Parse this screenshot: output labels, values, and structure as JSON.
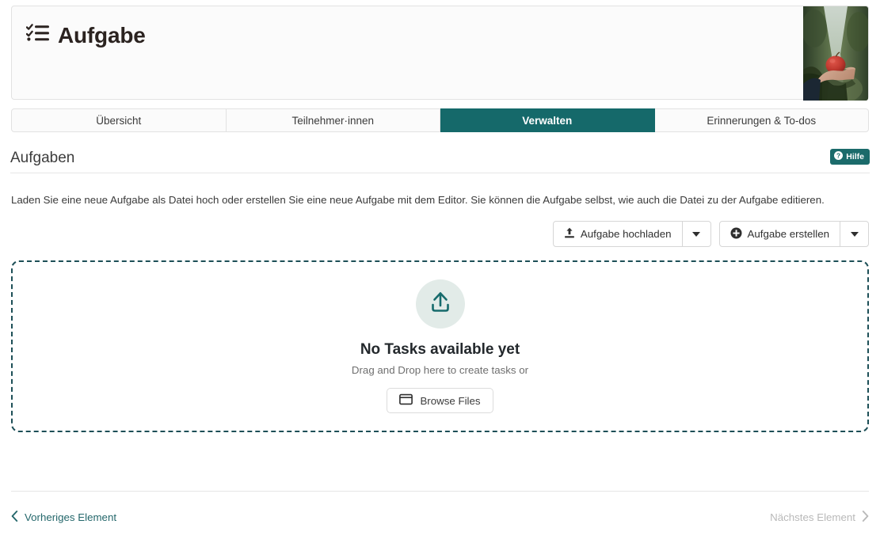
{
  "header": {
    "title": "Aufgabe",
    "icon": "tasklist-icon",
    "thumbnail_alt": "hand holding red apple in orchard"
  },
  "tabs": [
    {
      "label": "Übersicht",
      "active": false
    },
    {
      "label": "Teilnehmer·innen",
      "active": false
    },
    {
      "label": "Verwalten",
      "active": true
    },
    {
      "label": "Erinnerungen & To-dos",
      "active": false
    }
  ],
  "section": {
    "title": "Aufgaben",
    "help_label": "Hilfe",
    "description": "Laden Sie eine neue Aufgabe als Datei hoch oder erstellen Sie eine neue Aufgabe mit dem Editor. Sie können die Aufgabe selbst, wie auch die Datei zu der Aufgabe editieren."
  },
  "actions": {
    "upload_label": "Aufgabe hochladen",
    "create_label": "Aufgabe erstellen"
  },
  "dropzone": {
    "title": "No Tasks available yet",
    "subtitle": "Drag and Drop here to create tasks or",
    "browse_label": "Browse Files"
  },
  "footer": {
    "prev_label": "Vorheriges Element",
    "next_label": "Nächstes Element"
  },
  "colors": {
    "accent_teal": "#15696a",
    "help_teal": "#1b6b6b",
    "dropzone_border": "#1d4f57",
    "dropzone_circle": "#e2ebe8",
    "link_teal": "#24676b",
    "disabled_gray": "#b9b9b9"
  }
}
